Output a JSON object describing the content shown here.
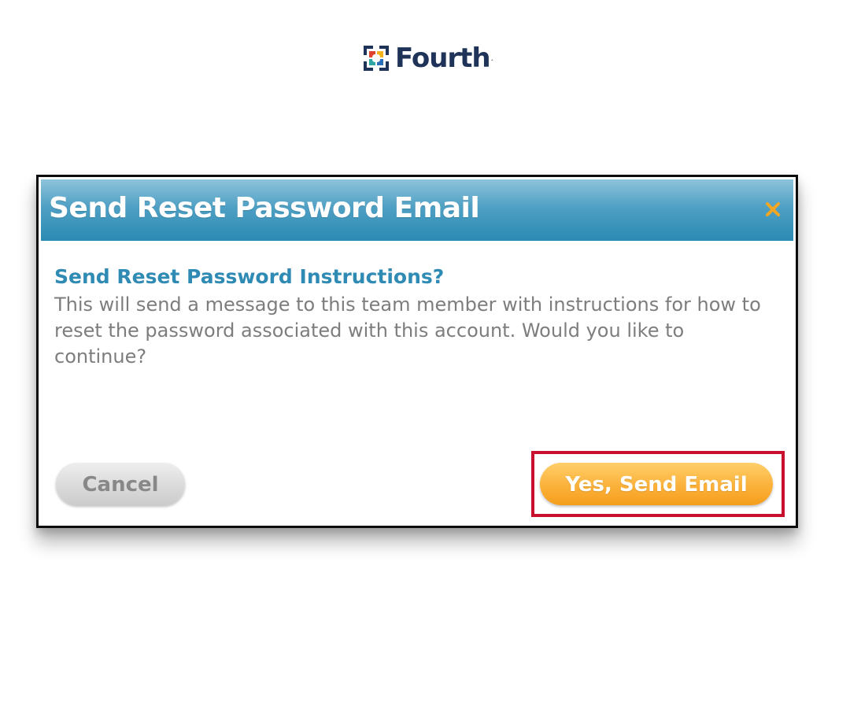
{
  "brand": {
    "name": "Fourth",
    "trademark": ".",
    "colors": {
      "navy": "#1f3358",
      "red": "#e0432b",
      "yellow": "#f5b31a",
      "teal": "#2ea7a0",
      "blue": "#2b6fb8"
    }
  },
  "dialog": {
    "title": "Send Reset Password Email",
    "close_icon": "close-icon",
    "heading": "Send Reset Password Instructions?",
    "message": "This will send a message to this team member with instructions for how to reset the password associated with this account. Would you like to continue?",
    "cancel_label": "Cancel",
    "confirm_label": "Yes, Send Email",
    "colors": {
      "header": "#2b8ab3",
      "heading_text": "#2f8ab4",
      "confirm_button": "#f9a72a",
      "close_icon": "#f5a623",
      "highlight": "#c8102e"
    }
  }
}
